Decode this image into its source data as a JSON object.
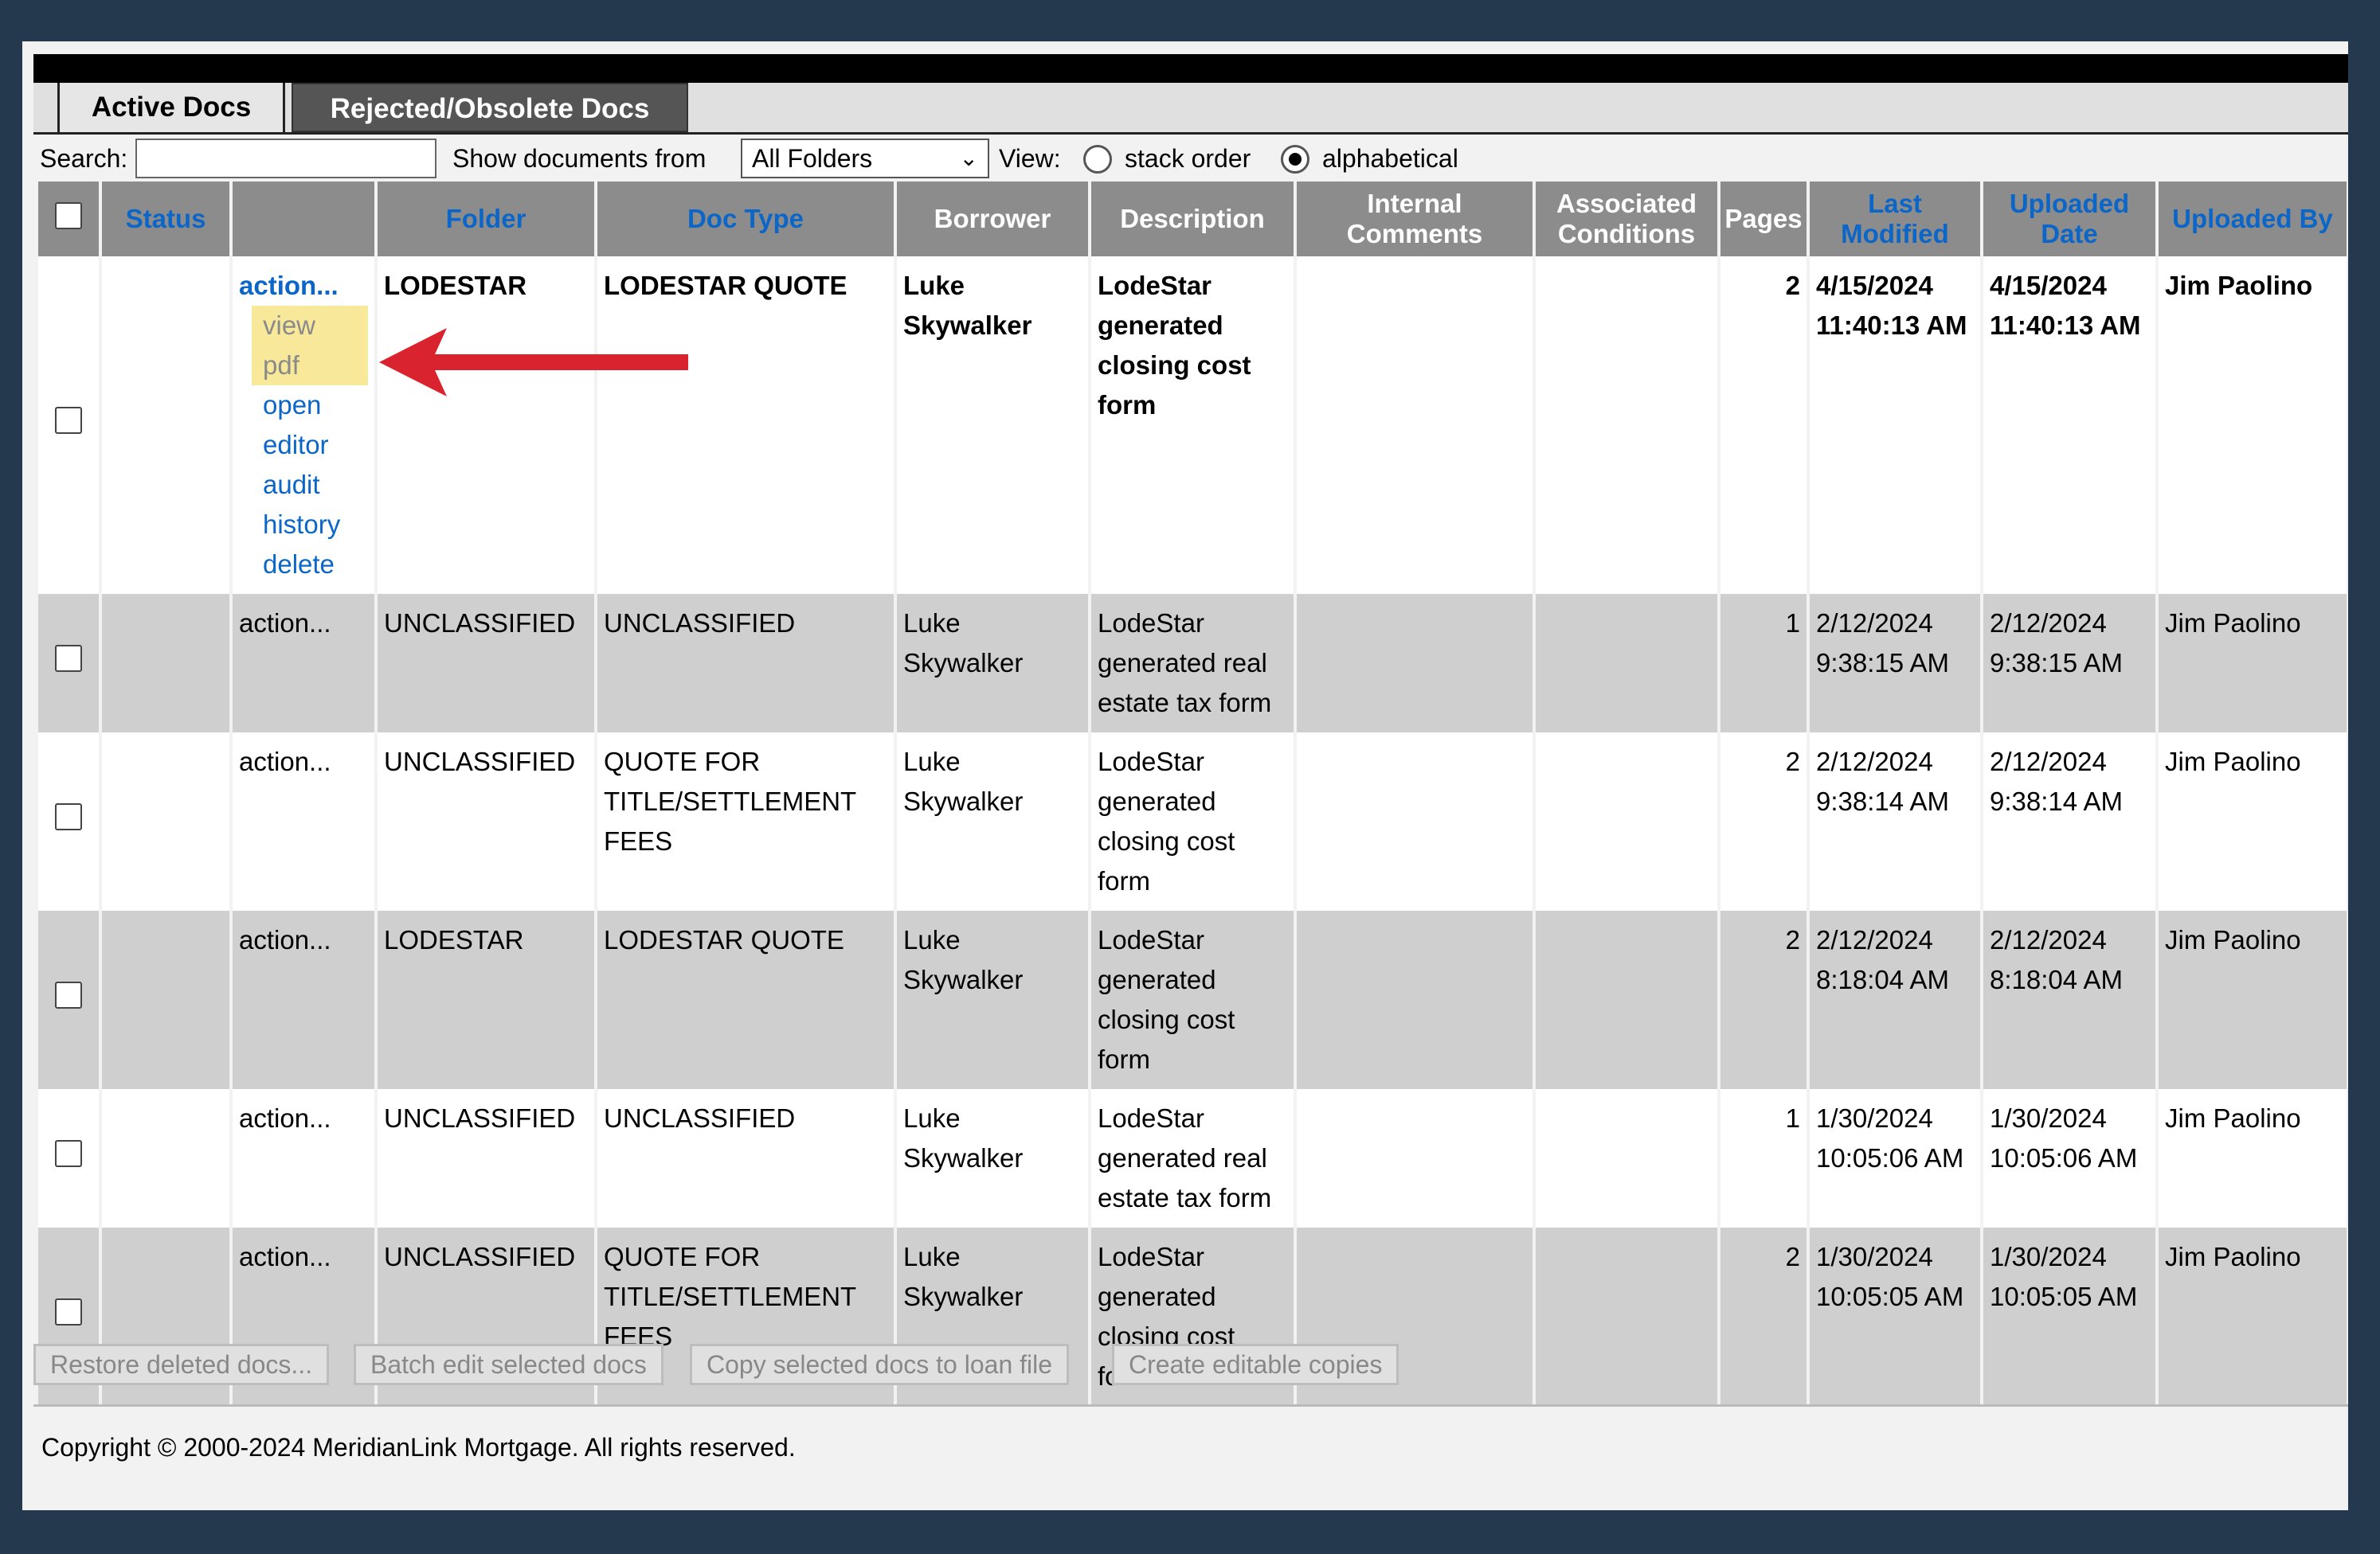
{
  "tabs": [
    {
      "label": "Active Docs"
    },
    {
      "label": "Rejected/Obsolete Docs"
    }
  ],
  "search": {
    "label": "Search:",
    "value": ""
  },
  "show_from": {
    "label": "Show documents from",
    "selected": "All Folders"
  },
  "view": {
    "label": "View:",
    "options": [
      "stack order",
      "alphabetical"
    ],
    "selected": "alphabetical"
  },
  "columns": [
    "Status",
    "",
    "Folder",
    "Doc Type",
    "Borrower",
    "Description",
    "Internal Comments",
    "Associated Conditions",
    "Pages",
    "Last Modified",
    "Uploaded Date",
    "Uploaded By"
  ],
  "action_menu": {
    "label": "action...",
    "items": [
      "view pdf",
      "open",
      "editor",
      "audit",
      "history",
      "delete"
    ],
    "highlighted": "view pdf"
  },
  "rows": [
    {
      "action": "action...",
      "folder": "LODESTAR",
      "doctype": "LODESTAR QUOTE",
      "borrower": "Luke Skywalker",
      "description": "LodeStar generated closing cost form",
      "comments": "",
      "conditions": "",
      "pages": "2",
      "modified": "4/15/2024 11:40:13 AM",
      "uploaded": "4/15/2024 11:40:13 AM",
      "by": "Jim Paolino"
    },
    {
      "action": "action...",
      "folder": "UNCLASSIFIED",
      "doctype": "UNCLASSIFIED",
      "borrower": "Luke Skywalker",
      "description": "LodeStar generated real estate tax form",
      "comments": "",
      "conditions": "",
      "pages": "1",
      "modified": "2/12/2024 9:38:15 AM",
      "uploaded": "2/12/2024 9:38:15 AM",
      "by": "Jim Paolino"
    },
    {
      "action": "action...",
      "folder": "UNCLASSIFIED",
      "doctype": "QUOTE FOR TITLE/SETTLEMENT FEES",
      "borrower": "Luke Skywalker",
      "description": "LodeStar generated closing cost form",
      "comments": "",
      "conditions": "",
      "pages": "2",
      "modified": "2/12/2024 9:38:14 AM",
      "uploaded": "2/12/2024 9:38:14 AM",
      "by": "Jim Paolino"
    },
    {
      "action": "action...",
      "folder": "LODESTAR",
      "doctype": "LODESTAR QUOTE",
      "borrower": "Luke Skywalker",
      "description": "LodeStar generated closing cost form",
      "comments": "",
      "conditions": "",
      "pages": "2",
      "modified": "2/12/2024 8:18:04 AM",
      "uploaded": "2/12/2024 8:18:04 AM",
      "by": "Jim Paolino"
    },
    {
      "action": "action...",
      "folder": "UNCLASSIFIED",
      "doctype": "UNCLASSIFIED",
      "borrower": "Luke Skywalker",
      "description": "LodeStar generated real estate tax form",
      "comments": "",
      "conditions": "",
      "pages": "1",
      "modified": "1/30/2024 10:05:06 AM",
      "uploaded": "1/30/2024 10:05:06 AM",
      "by": "Jim Paolino"
    },
    {
      "action": "action...",
      "folder": "UNCLASSIFIED",
      "doctype": "QUOTE FOR TITLE/SETTLEMENT FEES",
      "borrower": "Luke Skywalker",
      "description": "LodeStar generated closing cost form",
      "comments": "",
      "conditions": "",
      "pages": "2",
      "modified": "1/30/2024 10:05:05 AM",
      "uploaded": "1/30/2024 10:05:05 AM",
      "by": "Jim Paolino"
    }
  ],
  "buttons": [
    "Restore deleted docs...",
    "Batch edit selected docs",
    "Copy selected docs to loan file",
    "Create editable copies"
  ],
  "copyright": "Copyright © 2000-2024 MeridianLink Mortgage. All rights reserved.",
  "colors": {
    "link": "#0b66c8",
    "header_bg": "#8c8c8c",
    "annotation_arrow": "#d9232e",
    "highlight": "#f7e89a"
  }
}
